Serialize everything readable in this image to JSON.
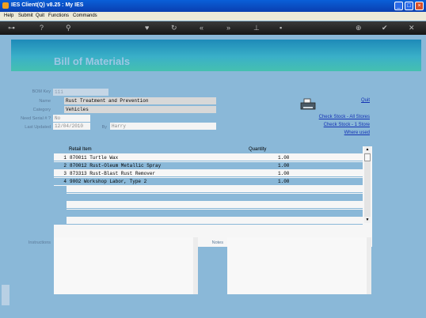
{
  "window": {
    "title": "IES Client(Q) v8.25 : My IES"
  },
  "menu": [
    "Help",
    "Submit",
    "Quit",
    "Functions",
    "Commands"
  ],
  "toolbar_icons": [
    "key-icon",
    "help-icon",
    "search-icon",
    "heart-icon",
    "history-icon",
    "rewind-icon",
    "fast-forward-icon",
    "pin-icon",
    "note-icon",
    "add-icon",
    "confirm-icon",
    "close-icon"
  ],
  "page": {
    "title": "Bill of Materials"
  },
  "form": {
    "bom_key_label": "BOM Key",
    "bom_key": "111",
    "name_label": "Name",
    "name": "Rust Treatment and Prevention",
    "category_label": "Category",
    "category": "Vehicles",
    "need_serial_label": "Need Serial # ?",
    "need_serial": "No",
    "last_updated_label": "Last Updated",
    "last_updated": "12/04/2010",
    "by_label": "By",
    "by": "Harry"
  },
  "links": {
    "quit": "Quit",
    "check_all": "Check Stock - All Stores",
    "check_one": "Check Stock - 1 Store",
    "where_used": "Where used"
  },
  "grid": {
    "col_item": "Retail Item",
    "col_qty": "Quantity",
    "rows": [
      {
        "n": "1",
        "item": "870011 Turtle Wax",
        "qty": "1.00"
      },
      {
        "n": "2",
        "item": "870012 Rust-Oleum Metallic Spray",
        "qty": "1.00"
      },
      {
        "n": "3",
        "item": "873313 Rust-Blast Rust Remover",
        "qty": "1.00"
      },
      {
        "n": "4",
        "item": "9002 Workshop Labor, Type 2",
        "qty": "1.00"
      }
    ]
  },
  "memos": {
    "instructions_label": "Instructions",
    "notes_label": "Notes"
  },
  "colors": {
    "accent": "#1e8ab8",
    "background": "#8ab8d8",
    "titlebar": "#0a4fc8"
  }
}
